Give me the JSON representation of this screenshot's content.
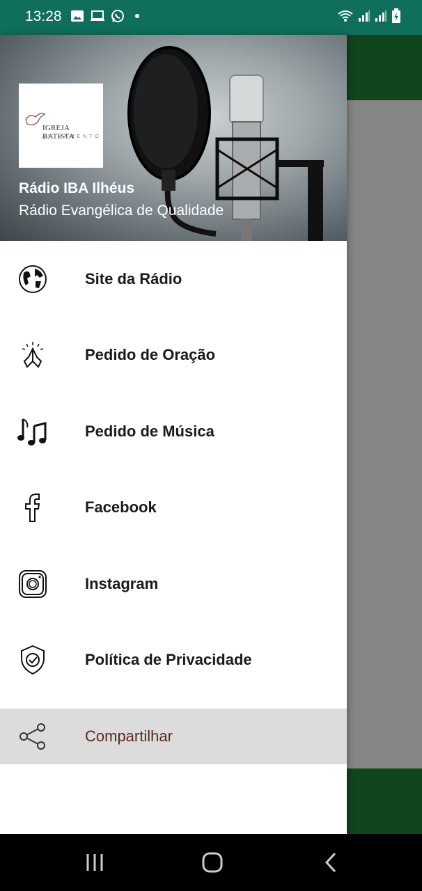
{
  "status_bar": {
    "time": "13:28",
    "left_icons": [
      "image-icon",
      "laptop-icon",
      "whatsapp-icon",
      "dot-icon"
    ],
    "right_icons": [
      "wifi-icon",
      "signal-icon",
      "signal-icon",
      "battery-charging-icon"
    ]
  },
  "drawer": {
    "logo": {
      "line1": "IGREJA BATISTA",
      "line2": "AVIVAMENTO"
    },
    "title": "Rádio IBA Ilhéus",
    "subtitle": "Rádio Evangélica de Qualidade",
    "items": [
      {
        "label": "Site da Rádio",
        "icon": "globe-icon"
      },
      {
        "label": "Pedido de Oração",
        "icon": "praying-hands-icon"
      },
      {
        "label": "Pedido de Música",
        "icon": "music-notes-icon"
      },
      {
        "label": "Facebook",
        "icon": "facebook-icon"
      },
      {
        "label": "Instagram",
        "icon": "instagram-icon"
      },
      {
        "label": "Política de Privacidade",
        "icon": "shield-check-icon"
      },
      {
        "label": "Compartilhar",
        "icon": "share-icon",
        "selected": true
      }
    ]
  },
  "colors": {
    "status_bar": "#0f6e5c",
    "app_green": "#1e7d36",
    "selected_bg": "#dcdcdc",
    "selected_text": "#5a2a22"
  },
  "nav_bar": {
    "buttons": [
      "recent-apps-icon",
      "home-icon",
      "back-icon"
    ]
  }
}
